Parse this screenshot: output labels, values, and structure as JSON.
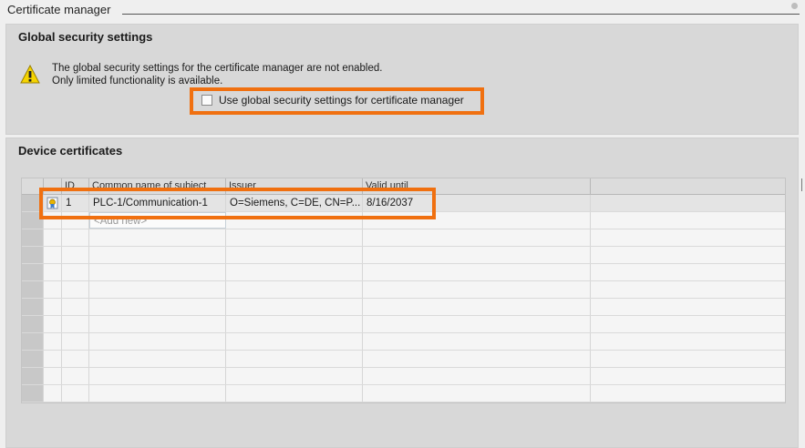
{
  "page": {
    "title": "Certificate manager"
  },
  "global_security": {
    "title": "Global security settings",
    "warning_line1": "The global security settings for the certificate manager are not enabled.",
    "warning_line2": "Only limited functionality is available.",
    "checkbox_label": "Use global security settings for certificate manager",
    "checkbox_checked": false
  },
  "device_certificates": {
    "title": "Device certificates",
    "columns": [
      "ID",
      "Common name of subject",
      "Issuer",
      "Valid until"
    ],
    "rows": [
      {
        "id": "1",
        "common_name": "PLC-1/Communication-1",
        "issuer": "O=Siemens, C=DE, CN=P...",
        "valid_until": "8/16/2037"
      }
    ],
    "add_new": "<Add new>"
  },
  "colors": {
    "highlight": "#f07010",
    "panel": "#d8d8d8",
    "warning": "#f5d400"
  }
}
